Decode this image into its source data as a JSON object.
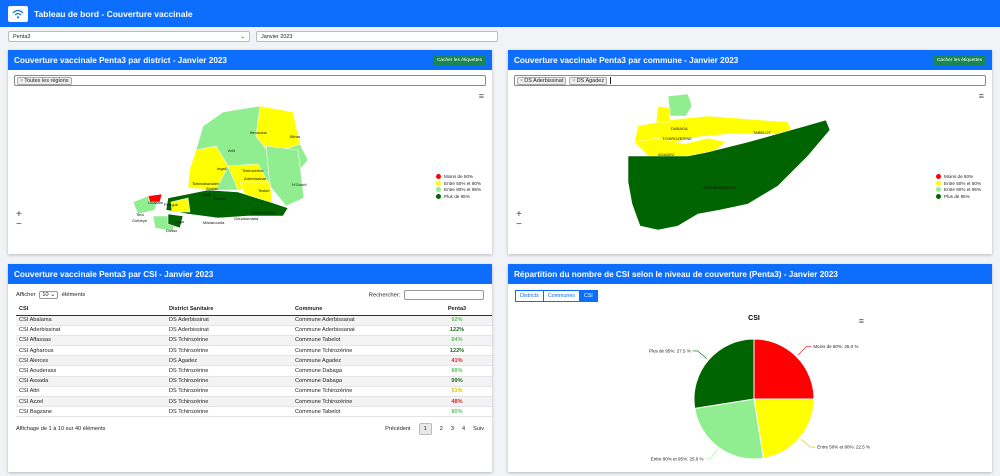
{
  "app": {
    "title": "Tableau de bord - Couverture vaccinale",
    "logo_icon": "wifi-icon"
  },
  "filters": {
    "vaccine": "Penta3",
    "period": "Janvier 2023"
  },
  "colors": {
    "red": "#ff0000",
    "yellow": "#ffff00",
    "light_green": "#90ee90",
    "dark_green": "#006400",
    "primary": "#0d6efd",
    "success": "#198754"
  },
  "legend": [
    "Moins de 50%",
    "Entre 50% et 80%",
    "Entre 80% et 95%",
    "Plus de 95%"
  ],
  "district_map": {
    "title": "Couverture vaccinale Penta3 par district - Janvier 2023",
    "toggle_label": "Cacher les étiquettes",
    "tags": [
      "Toutes les régions"
    ],
    "labels": [
      "Arlit",
      "Iferouane",
      "Bilma",
      "Ingall",
      "Tchirozérine",
      "Aderbissinat",
      "Tchintabaraden",
      "Abalak",
      "Tesker",
      "N'Gourti",
      "Keita",
      "Bouza",
      "Filingué",
      "Ouallam",
      "Tera",
      "Gothèye",
      "Loga",
      "Dosso",
      "Gaya",
      "Madarounfa",
      "Goudoumaria",
      "Mainé-Soroa"
    ]
  },
  "commune_map": {
    "title": "Couverture vaccinale Penta3 par commune - Janvier 2023",
    "toggle_label": "Cacher les étiquettes",
    "tags": [
      "DS Aderbissinat",
      "DS Agadez"
    ],
    "labels": [
      "TABELOT",
      "DABAGA",
      "TCHIROZERINE",
      "AGADEZ",
      "AZERBEKANDAN"
    ]
  },
  "csi_table": {
    "title": "Couverture vaccinale Penta3 par CSI - Janvier 2023",
    "show_label": "Afficher",
    "page_size": "10",
    "entries_label": "éléments",
    "search_label": "Rechercher:",
    "columns": [
      "CSI",
      "District Sanitaire",
      "Commune",
      "Penta3"
    ],
    "rows": [
      {
        "csi": "CSI Abalama",
        "district": "DS Aderbissinat",
        "commune": "Commune Aderbissanat",
        "penta3": "92%",
        "color": "#62c462"
      },
      {
        "csi": "CSI Aderbissinat",
        "district": "DS Aderbissinat",
        "commune": "Commune Aderbissanat",
        "penta3": "122%",
        "color": "#1e6b1e"
      },
      {
        "csi": "CSI Affassas",
        "district": "DS Tchirozérine",
        "commune": "Commune Tabelot",
        "penta3": "84%",
        "color": "#62c462"
      },
      {
        "csi": "CSI Agharous",
        "district": "DS Tchirozérine",
        "commune": "Commune Tchirozérine",
        "penta3": "122%",
        "color": "#1e6b1e"
      },
      {
        "csi": "CSI Alerces",
        "district": "DS Agadez",
        "commune": "Commune Agadez",
        "penta3": "41%",
        "color": "#e02020"
      },
      {
        "csi": "CSI Aouderass",
        "district": "DS Tchirozérine",
        "commune": "Commune Dabaga",
        "penta3": "88%",
        "color": "#62c462"
      },
      {
        "csi": "CSI Assada",
        "district": "DS Tchirozérine",
        "commune": "Commune Dabaga",
        "penta3": "99%",
        "color": "#1e6b1e"
      },
      {
        "csi": "CSI Attri",
        "district": "DS Tchirozérine",
        "commune": "Commune Tchirozérine",
        "penta3": "51%",
        "color": "#e0c000"
      },
      {
        "csi": "CSI Azzel",
        "district": "DS Tchirozérine",
        "commune": "Commune Tchirozérine",
        "penta3": "48%",
        "color": "#e02020"
      },
      {
        "csi": "CSI Bagzane",
        "district": "DS Tchirozérine",
        "commune": "Commune Tabelot",
        "penta3": "80%",
        "color": "#62c462"
      }
    ],
    "info": "Affichage de 1 à 10 sur 40 éléments",
    "prev_label": "Précédent",
    "pages": [
      "1",
      "2",
      "3",
      "4"
    ],
    "next_label": "Suiv"
  },
  "pie_panel": {
    "title": "Répartition du nombre de CSI selon le niveau de couverture (Penta3) - Janvier 2023",
    "tabs": [
      "Districts",
      "Communes",
      "CSI"
    ],
    "active_tab": "CSI"
  },
  "chart_data": {
    "type": "pie",
    "title": "CSI",
    "series": [
      {
        "name": "Moins de 50%",
        "value": 25.0,
        "label": "Moins de 50%: 25.0 %",
        "color": "#ff0000"
      },
      {
        "name": "Entre 50% et 80%",
        "value": 22.5,
        "label": "Entre 50% et 80%: 22.5 %",
        "color": "#ffff00"
      },
      {
        "name": "Entre 80% et 95%",
        "value": 25.0,
        "label": "Entre 80% et 95%: 25.0 %",
        "color": "#90ee90"
      },
      {
        "name": "Plus de 95%",
        "value": 27.5,
        "label": "Plus de 95%: 27.5 %",
        "color": "#006400"
      }
    ]
  }
}
